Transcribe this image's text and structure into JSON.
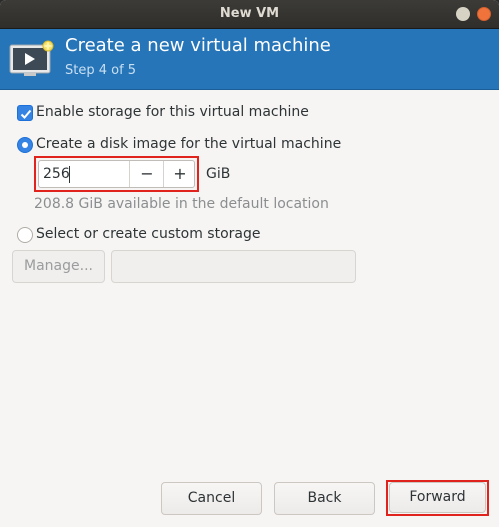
{
  "window": {
    "title": "New VM"
  },
  "header": {
    "title": "Create a new virtual machine",
    "step": "Step 4 of 5"
  },
  "storage": {
    "enable_label": "Enable storage for this virtual machine",
    "enable_checked": true,
    "create_disk_label": "Create a disk image for the virtual machine",
    "create_disk_selected": true,
    "disk_size_value": "256",
    "disk_size_unit": "GiB",
    "available_text": "208.8 GiB available in the default location",
    "custom_storage_label": "Select or create custom storage",
    "custom_storage_selected": false,
    "manage_label": "Manage...",
    "custom_path_value": ""
  },
  "buttons": {
    "cancel": "Cancel",
    "back": "Back",
    "forward": "Forward"
  },
  "colors": {
    "header_bg": "#2675b8",
    "accent": "#3584e4",
    "highlight": "#e0231c"
  }
}
